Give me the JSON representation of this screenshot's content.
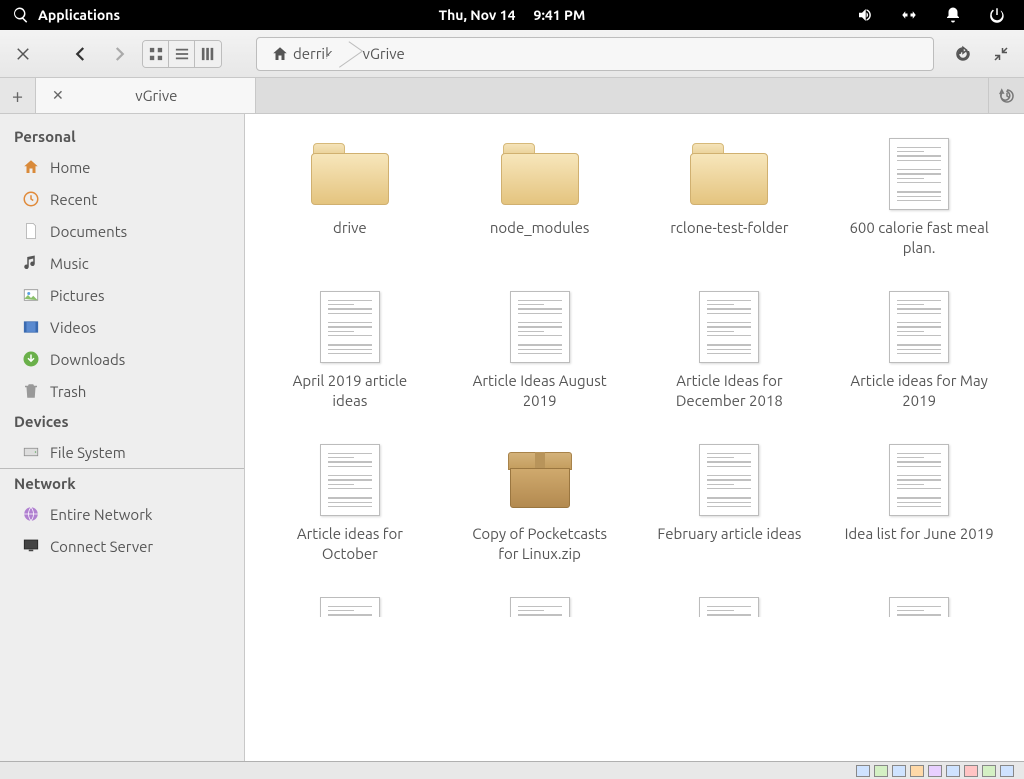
{
  "panel": {
    "apps_label": "Applications",
    "date": "Thu, Nov 14",
    "time": "9:41 PM"
  },
  "toolbar": {
    "breadcrumb": [
      "derrik",
      "vGrive"
    ]
  },
  "tabs": {
    "active_label": "vGrive"
  },
  "sidebar": {
    "sections": {
      "personal": {
        "title": "Personal",
        "items": [
          {
            "id": "home",
            "label": "Home"
          },
          {
            "id": "recent",
            "label": "Recent"
          },
          {
            "id": "documents",
            "label": "Documents"
          },
          {
            "id": "music",
            "label": "Music"
          },
          {
            "id": "pictures",
            "label": "Pictures"
          },
          {
            "id": "videos",
            "label": "Videos"
          },
          {
            "id": "downloads",
            "label": "Downloads"
          },
          {
            "id": "trash",
            "label": "Trash"
          }
        ]
      },
      "devices": {
        "title": "Devices",
        "items": [
          {
            "id": "filesystem",
            "label": "File System"
          }
        ]
      },
      "network": {
        "title": "Network",
        "items": [
          {
            "id": "entire-network",
            "label": "Entire Network"
          },
          {
            "id": "connect-server",
            "label": "Connect Server"
          }
        ]
      }
    }
  },
  "files": [
    {
      "type": "folder",
      "label": "drive"
    },
    {
      "type": "folder",
      "label": "node_modules"
    },
    {
      "type": "folder",
      "label": "rclone-test-folder"
    },
    {
      "type": "doc",
      "label": "600 calorie fast meal plan."
    },
    {
      "type": "doc",
      "label": "April 2019 article ideas"
    },
    {
      "type": "doc",
      "label": "Article Ideas August 2019"
    },
    {
      "type": "doc",
      "label": "Article Ideas for December 2018"
    },
    {
      "type": "doc",
      "label": "Article ideas for May 2019"
    },
    {
      "type": "doc",
      "label": "Article ideas for October"
    },
    {
      "type": "box",
      "label": "Copy of Pocketcasts for Linux.zip"
    },
    {
      "type": "doc",
      "label": "February article ideas"
    },
    {
      "type": "doc",
      "label": "Idea list for June 2019"
    }
  ]
}
